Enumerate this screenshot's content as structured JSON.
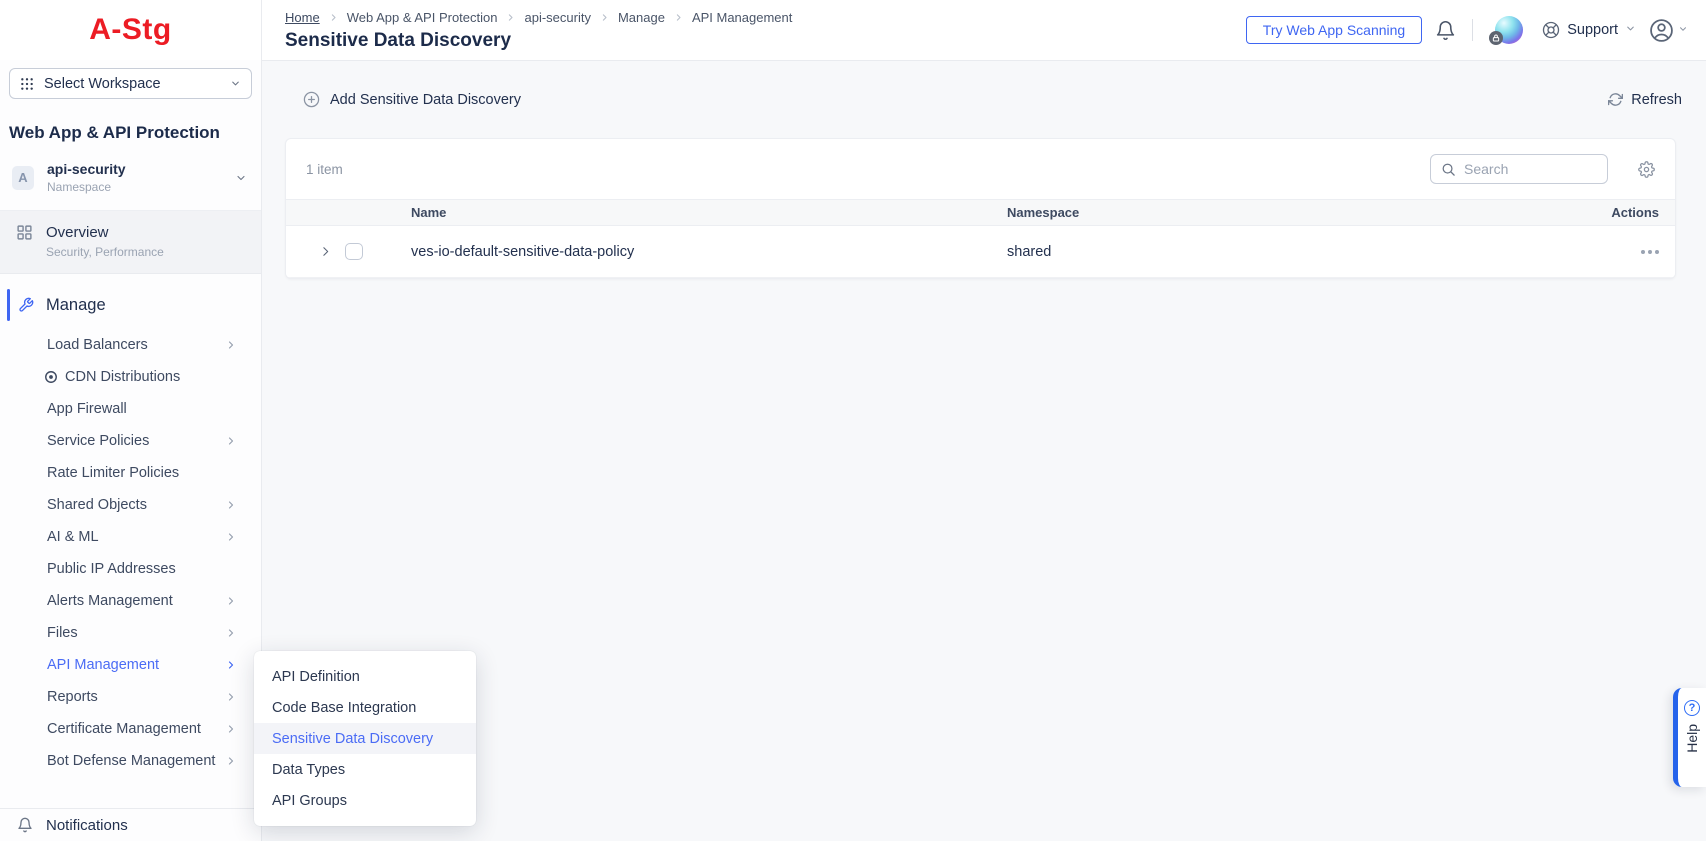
{
  "app": {
    "logo_text": "A-Stg"
  },
  "sidebar": {
    "workspace_selector_label": "Select Workspace",
    "section_title": "Web App & API Protection",
    "namespace_card": {
      "avatar_letter": "A",
      "name": "api-security",
      "sublabel": "Namespace"
    },
    "overview_item": {
      "label": "Overview",
      "sublabel": "Security, Performance"
    },
    "manage_section_label": "Manage",
    "manage_items": [
      {
        "label": "Load Balancers",
        "chevron": true
      },
      {
        "label": "CDN Distributions",
        "icon": true
      },
      {
        "label": "App Firewall"
      },
      {
        "label": "Service Policies",
        "chevron": true
      },
      {
        "label": "Rate Limiter Policies"
      },
      {
        "label": "Shared Objects",
        "chevron": true
      },
      {
        "label": "AI & ML",
        "chevron": true
      },
      {
        "label": "Public IP Addresses"
      },
      {
        "label": "Alerts Management",
        "chevron": true
      },
      {
        "label": "Files",
        "chevron": true
      },
      {
        "label": "API Management",
        "chevron": true,
        "active": true
      },
      {
        "label": "Reports",
        "chevron": true
      },
      {
        "label": "Certificate Management",
        "chevron": true
      },
      {
        "label": "Bot Defense Management",
        "chevron": true
      }
    ],
    "notifications_label": "Notifications"
  },
  "api_management_flyout": {
    "items": [
      {
        "label": "API Definition"
      },
      {
        "label": "Code Base Integration"
      },
      {
        "label": "Sensitive Data Discovery",
        "active": true
      },
      {
        "label": "Data Types"
      },
      {
        "label": "API Groups"
      }
    ]
  },
  "header": {
    "breadcrumbs": [
      {
        "label": "Home",
        "home": true
      },
      {
        "label": "Web App & API Protection"
      },
      {
        "label": "api-security"
      },
      {
        "label": "Manage"
      },
      {
        "label": "API Management"
      }
    ],
    "page_title": "Sensitive Data Discovery",
    "try_web_app_scanning_button": "Try Web App Scanning",
    "support_label": "Support"
  },
  "content_toolbar": {
    "add_button_label": "Add Sensitive Data Discovery",
    "refresh_button_label": "Refresh"
  },
  "table": {
    "item_count_label": "1 item",
    "search_placeholder": "Search",
    "columns": {
      "name": "Name",
      "namespace": "Namespace",
      "actions": "Actions"
    },
    "rows": [
      {
        "name": "ves-io-default-sensitive-data-policy",
        "namespace": "shared"
      }
    ]
  },
  "help_tab_label": "Help",
  "icons": {
    "workspace_icon": "grid-dots",
    "overview_icon": "grid-squares",
    "manage_icon": "wrench",
    "cdn_icon": "disc",
    "notifications_icon": "bell",
    "support_icon": "lifebuoy",
    "account_icon": "user-circle",
    "assistant_icon": "gradient-sphere-with-lock-badge",
    "help_icon": "question-circle"
  },
  "colors": {
    "accent_blue": "#3f66f2",
    "logo_red": "#ec1c24",
    "heading_navy": "#1c2b4a"
  }
}
